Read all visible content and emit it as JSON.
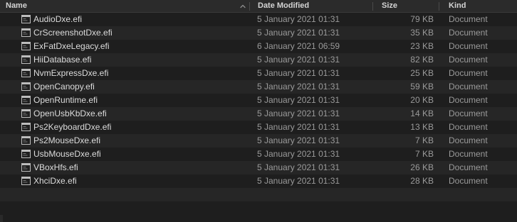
{
  "columns": {
    "name": "Name",
    "date": "Date Modified",
    "size": "Size",
    "kind": "Kind"
  },
  "sort": {
    "column": "name",
    "icon": "chevron-up-icon"
  },
  "files": [
    {
      "name": "AudioDxe.efi",
      "date": "5 January 2021 01:31",
      "size": "79 KB",
      "kind": "Document"
    },
    {
      "name": "CrScreenshotDxe.efi",
      "date": "5 January 2021 01:31",
      "size": "35 KB",
      "kind": "Document"
    },
    {
      "name": "ExFatDxeLegacy.efi",
      "date": "6 January 2021 06:59",
      "size": "23 KB",
      "kind": "Document"
    },
    {
      "name": "HiiDatabase.efi",
      "date": "5 January 2021 01:31",
      "size": "82 KB",
      "kind": "Document"
    },
    {
      "name": "NvmExpressDxe.efi",
      "date": "5 January 2021 01:31",
      "size": "25 KB",
      "kind": "Document"
    },
    {
      "name": "OpenCanopy.efi",
      "date": "5 January 2021 01:31",
      "size": "59 KB",
      "kind": "Document"
    },
    {
      "name": "OpenRuntime.efi",
      "date": "5 January 2021 01:31",
      "size": "20 KB",
      "kind": "Document"
    },
    {
      "name": "OpenUsbKbDxe.efi",
      "date": "5 January 2021 01:31",
      "size": "14 KB",
      "kind": "Document"
    },
    {
      "name": "Ps2KeyboardDxe.efi",
      "date": "5 January 2021 01:31",
      "size": "13 KB",
      "kind": "Document"
    },
    {
      "name": "Ps2MouseDxe.efi",
      "date": "5 January 2021 01:31",
      "size": "7 KB",
      "kind": "Document"
    },
    {
      "name": "UsbMouseDxe.efi",
      "date": "5 January 2021 01:31",
      "size": "7 KB",
      "kind": "Document"
    },
    {
      "name": "VBoxHfs.efi",
      "date": "5 January 2021 01:31",
      "size": "26 KB",
      "kind": "Document"
    },
    {
      "name": "XhciDxe.efi",
      "date": "5 January 2021 01:31",
      "size": "28 KB",
      "kind": "Document"
    }
  ],
  "file_icon": "document-icon",
  "colors": {
    "background": "#1e1e1e",
    "row_alt": "#262626",
    "header": "#2b2b2b",
    "name_text": "#dcdcdc",
    "secondary_text": "#9a9a9a"
  }
}
